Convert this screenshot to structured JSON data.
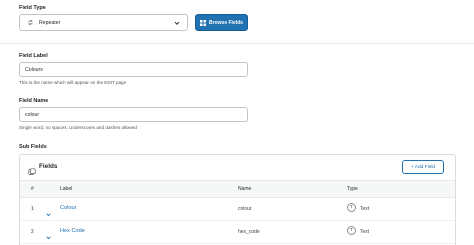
{
  "field_type": {
    "label": "Field Type",
    "selected": "Repeater",
    "browse_label": "Browse Fields"
  },
  "field_label": {
    "label": "Field Label",
    "value": "Colours",
    "help": "This is the name which will appear on the EDIT page"
  },
  "field_name": {
    "label": "Field Name",
    "value": "colour",
    "help": "Single word, no spaces. Underscores and dashes allowed"
  },
  "sub_fields": {
    "label": "Sub Fields",
    "title": "Fields",
    "add_label": "+ Add Field",
    "columns": {
      "order": "#",
      "label": "Label",
      "name": "Name",
      "type": "Type"
    },
    "rows": [
      {
        "order": "1",
        "label": "Colour",
        "name": "colour",
        "type": "Text",
        "type_icon": "T"
      },
      {
        "order": "2",
        "label": "Hex Code",
        "name": "hex_code",
        "type": "Text",
        "type_icon": "T"
      }
    ]
  },
  "colors": {
    "accent": "#2271b1"
  }
}
